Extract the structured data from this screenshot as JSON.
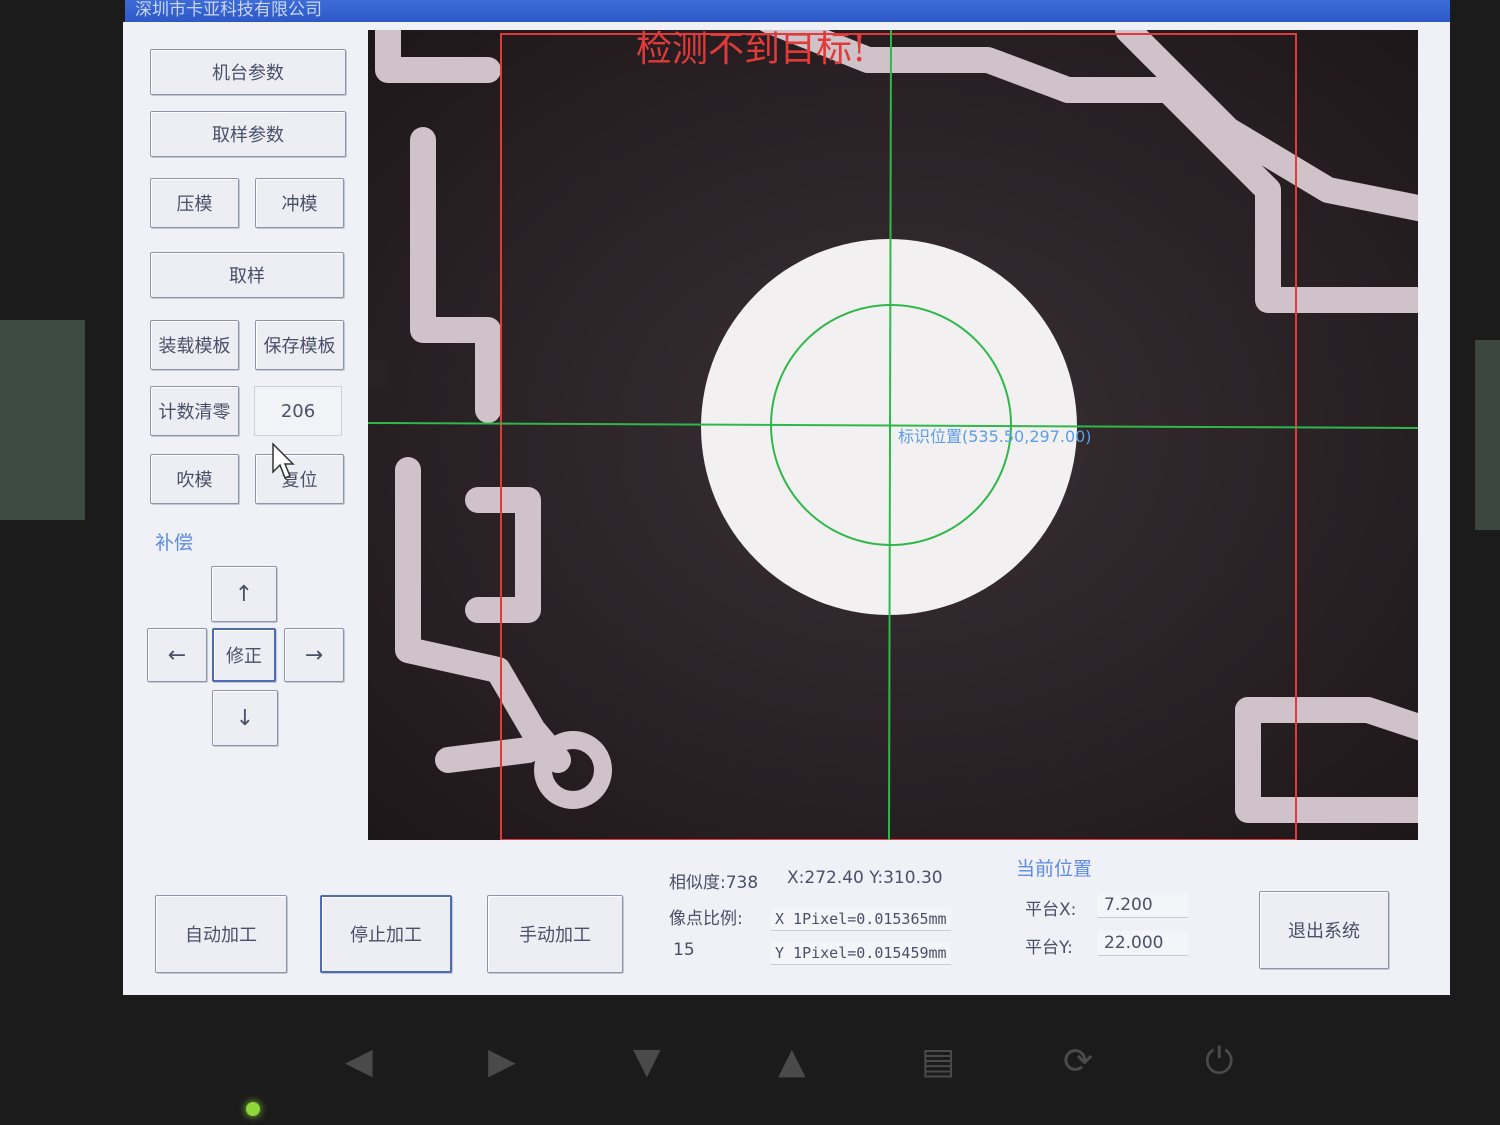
{
  "window": {
    "title": "深圳市卡亚科技有限公司"
  },
  "left_panel": {
    "machine_params": "机台参数",
    "sampling_params": "取样参数",
    "press_mold": "压模",
    "punch_mold": "冲模",
    "sample": "取样",
    "load_template": "装载模板",
    "save_template": "保存模板",
    "count_clear": "计数清零",
    "count_value": "206",
    "blow_mold": "吹模",
    "reset": "复位",
    "compensation_label": "补偿",
    "up": "↑",
    "down": "↓",
    "left": "←",
    "right": "→",
    "correct": "修正"
  },
  "camera": {
    "message": "检测不到目标!",
    "target_text": "标识位置(535.50,297.00)"
  },
  "bottom": {
    "auto_process": "自动加工",
    "stop_process": "停止加工",
    "manual_process": "手动加工",
    "similarity_text": "相似度:738",
    "coord_text": "X:272.40 Y:310.30",
    "pixel_ratio_label": "像点比例:",
    "pixel_ratio_value": "15",
    "x_pixel": "X 1Pixel=0.015365mm",
    "y_pixel": "Y 1Pixel=0.015459mm",
    "current_pos_label": "当前位置",
    "platform_x_label": "平台X:",
    "platform_x_value": "7.200",
    "platform_y_label": "平台Y:",
    "platform_y_value": "22.000",
    "exit": "退出系统"
  },
  "hardware": {
    "icons": [
      "◀",
      "▶",
      "▼",
      "▲",
      "▤",
      "⟳",
      "⏻"
    ]
  },
  "colors": {
    "title_bar": "#2c59c6",
    "accent_text": "#5d8be6",
    "roi_red": "#e03a3a",
    "crosshair_green": "#2fb84a",
    "led": "#8fd63a"
  }
}
